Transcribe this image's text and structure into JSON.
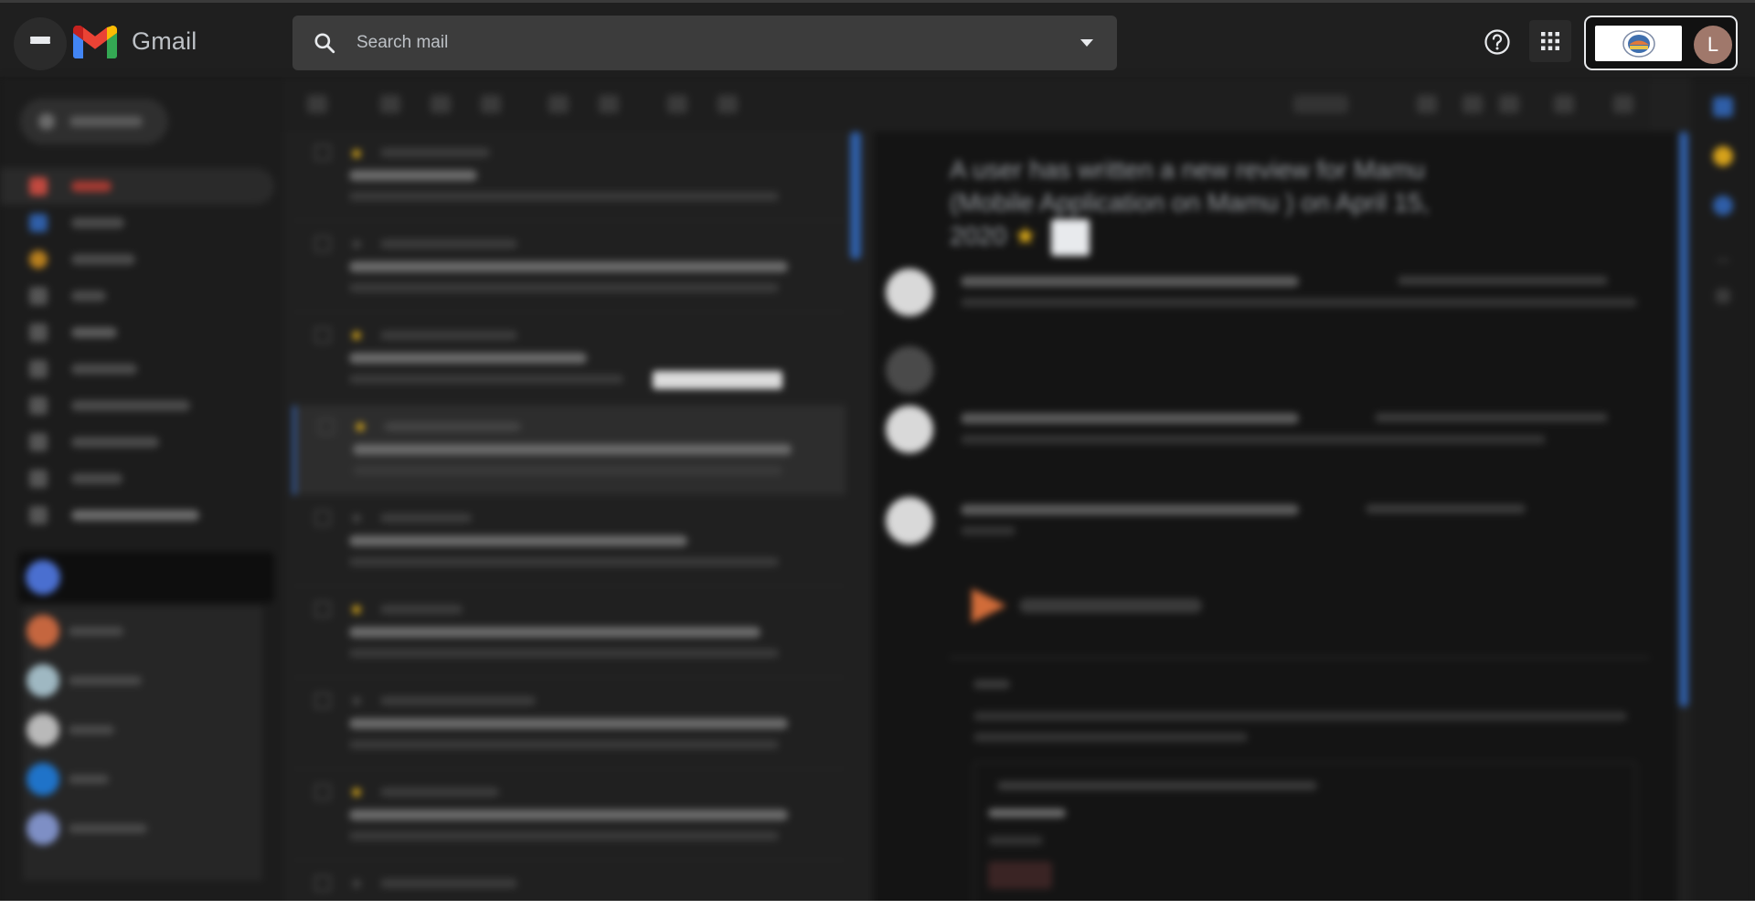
{
  "app": {
    "name": "Gmail"
  },
  "search": {
    "placeholder": "Search mail"
  },
  "account": {
    "avatar_letter": "L"
  },
  "colors": {
    "background": "#1a1a1a",
    "topbar": "#1f1f1f",
    "search_field": "#3c3c3c",
    "avatar": "#a0786b",
    "scrollbar": "#2f5ea7"
  },
  "icons": {
    "menu": "menu-icon",
    "logo": "gmail-logo-icon",
    "search": "search-icon",
    "search_options": "chevron-down-icon",
    "help": "help-icon",
    "apps": "apps-grid-icon"
  },
  "reading_pane": {
    "subject": "A user has written a new review for Mamu (Mobile Application on Mamu ) on April 15, 2020"
  }
}
